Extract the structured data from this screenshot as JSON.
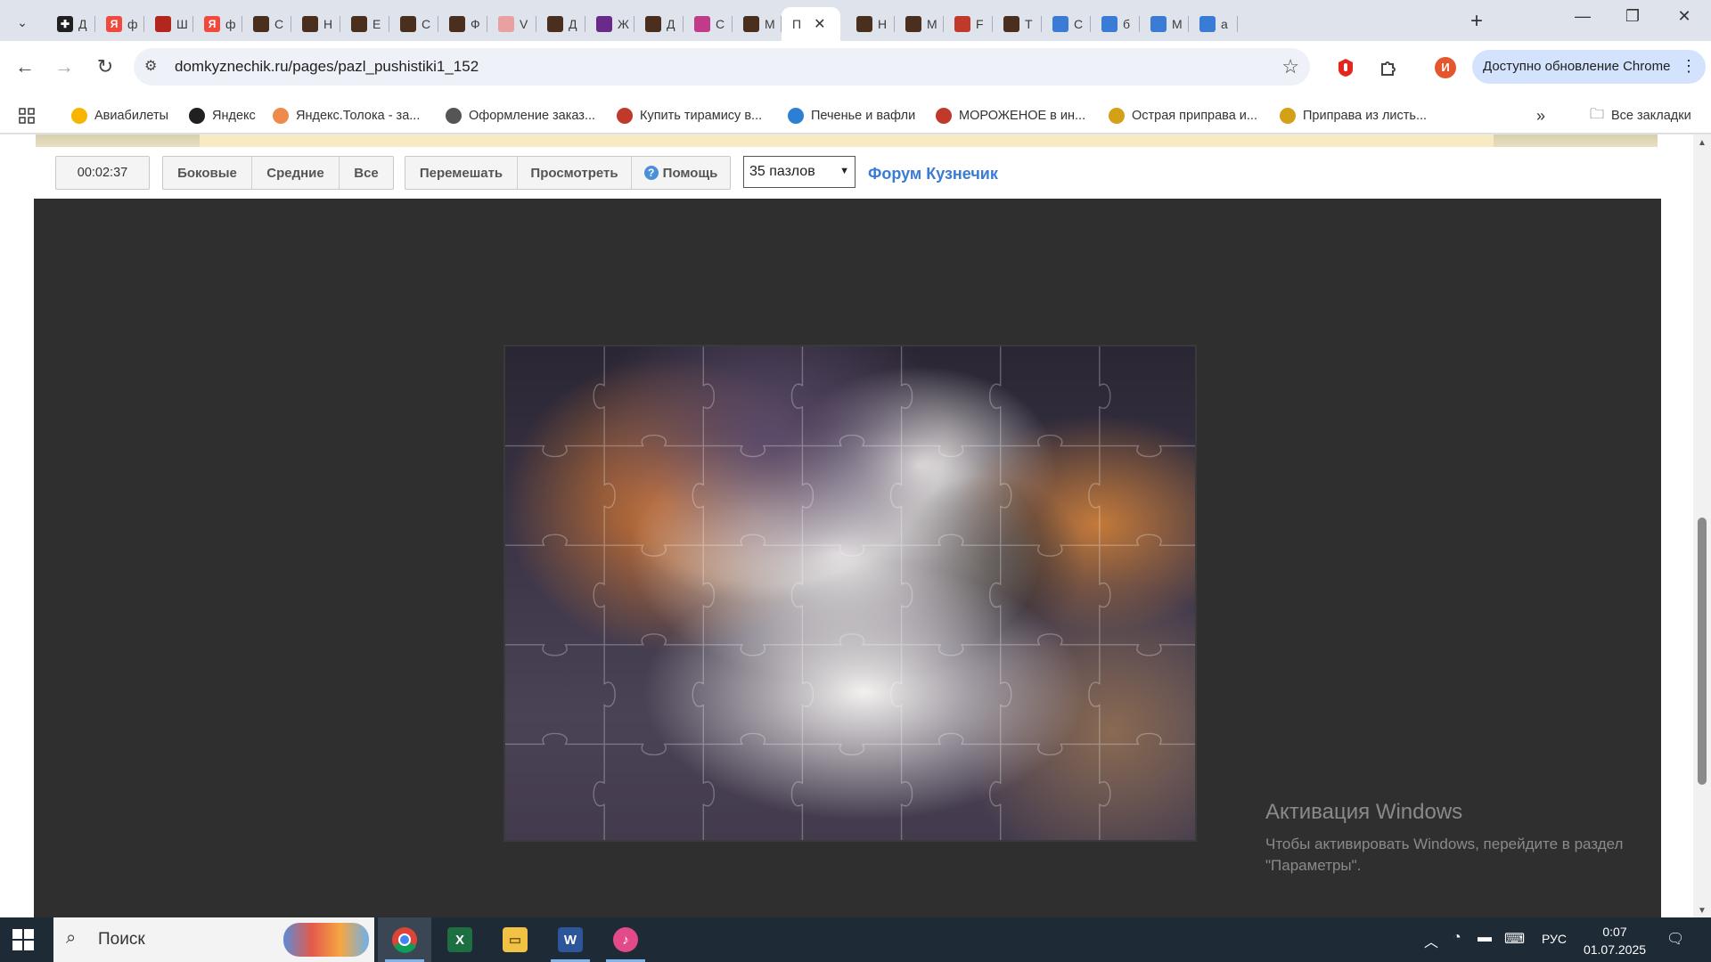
{
  "browser": {
    "tabs": [
      {
        "label": "Д",
        "fav_color": "#202020",
        "fav_glyph": "✚"
      },
      {
        "label": "ф",
        "fav_color": "#f04a3e",
        "fav_glyph": "Я"
      },
      {
        "label": "Ш",
        "fav_color": "#b3261e",
        "fav_glyph": ""
      },
      {
        "label": "ф",
        "fav_color": "#f04a3e",
        "fav_glyph": "Я"
      },
      {
        "label": "С",
        "fav_color": "#4a2e1e",
        "fav_glyph": ""
      },
      {
        "label": "Н",
        "fav_color": "#4a2e1e",
        "fav_glyph": ""
      },
      {
        "label": "Е",
        "fav_color": "#4a2e1e",
        "fav_glyph": ""
      },
      {
        "label": "С",
        "fav_color": "#4a2e1e",
        "fav_glyph": ""
      },
      {
        "label": "Ф",
        "fav_color": "#4a2e1e",
        "fav_glyph": ""
      },
      {
        "label": "V",
        "fav_color": "#e8a0a0",
        "fav_glyph": ""
      },
      {
        "label": "Д",
        "fav_color": "#4a2e1e",
        "fav_glyph": ""
      },
      {
        "label": "Ж",
        "fav_color": "#6a2a8a",
        "fav_glyph": ""
      },
      {
        "label": "Д",
        "fav_color": "#4a2e1e",
        "fav_glyph": ""
      },
      {
        "label": "С",
        "fav_color": "#c23a8a",
        "fav_glyph": ""
      },
      {
        "label": "М",
        "fav_color": "#4a2e1e",
        "fav_glyph": ""
      },
      {
        "label": "П",
        "fav_color": "",
        "fav_glyph": "",
        "active": true
      },
      {
        "label": "Н",
        "fav_color": "#4a2e1e",
        "fav_glyph": ""
      },
      {
        "label": "М",
        "fav_color": "#4a2e1e",
        "fav_glyph": ""
      },
      {
        "label": "F",
        "fav_color": "#c0392b",
        "fav_glyph": ""
      },
      {
        "label": "Т",
        "fav_color": "#4a2e1e",
        "fav_glyph": ""
      },
      {
        "label": "С",
        "fav_color": "#3a7bd5",
        "fav_glyph": ""
      },
      {
        "label": "б",
        "fav_color": "#3a7bd5",
        "fav_glyph": ""
      },
      {
        "label": "М",
        "fav_color": "#3a7bd5",
        "fav_glyph": ""
      },
      {
        "label": "а",
        "fav_color": "#3a7bd5",
        "fav_glyph": ""
      }
    ],
    "url": "domkyznechik.ru/pages/pazl_pushistiki1_152",
    "profile_initial": "И",
    "update_label": "Доступно обновление Chrome",
    "bookmarks": [
      {
        "label": "Авиабилеты",
        "color": "#f7b500"
      },
      {
        "label": "Яндекс",
        "color": "#202020"
      },
      {
        "label": "Яндекс.Толока - за...",
        "color": "#f08a4b"
      },
      {
        "label": "Оформление заказ...",
        "color": "#555555"
      },
      {
        "label": "Купить тирамису в...",
        "color": "#c0392b"
      },
      {
        "label": "Печенье и вафли",
        "color": "#2d7fd3"
      },
      {
        "label": "МОРОЖЕНОЕ в ин...",
        "color": "#c0392b"
      },
      {
        "label": "Острая приправа и...",
        "color": "#d4a017"
      },
      {
        "label": "Приправа из листь...",
        "color": "#d4a017"
      }
    ],
    "all_bookmarks_label": "Все закладки"
  },
  "page": {
    "timer": "00:02:37",
    "group1": [
      "Боковые",
      "Средние",
      "Все"
    ],
    "group2": [
      "Перемешать",
      "Просмотреть"
    ],
    "help_label": "Помощь",
    "pieces_value": "35 пазлов",
    "forum_link": "Форум Кузнечик"
  },
  "watermark": {
    "title": "Активация Windows",
    "line1": "Чтобы активировать Windows, перейдите в раздел",
    "line2": "\"Параметры\"."
  },
  "taskbar": {
    "search_label": "Поиск",
    "lang": "РУС",
    "time": "0:07",
    "date": "01.07.2025"
  }
}
